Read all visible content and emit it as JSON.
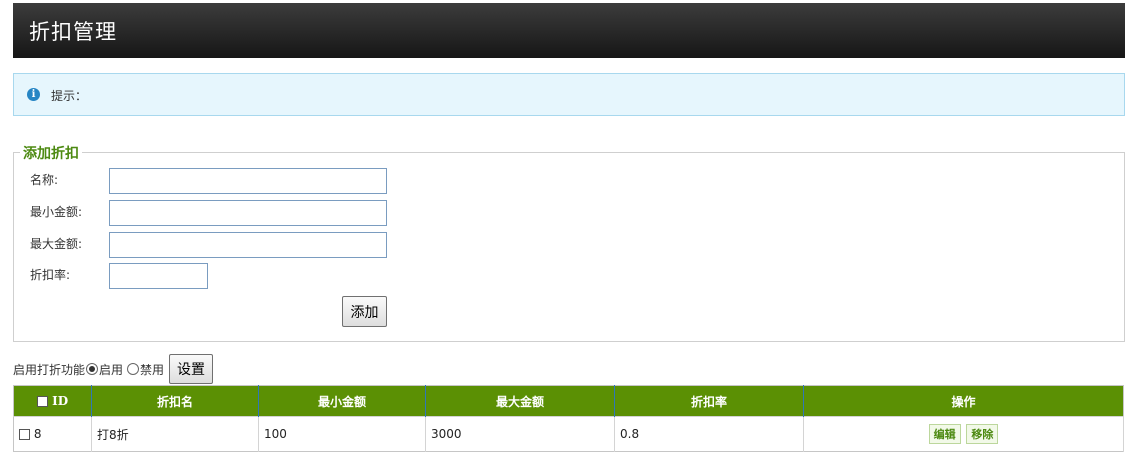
{
  "header": {
    "title": "折扣管理"
  },
  "tip": {
    "text": "提示："
  },
  "form": {
    "legend": "添加折扣",
    "name_label": "名称:",
    "name_value": "",
    "min_label": "最小金额:",
    "min_value": "",
    "max_label": "最大金额:",
    "max_value": "",
    "rate_label": "折扣率:",
    "rate_value": "",
    "submit_label": "添加"
  },
  "toggle": {
    "label": "启用打折功能",
    "enable_label": "启用",
    "disable_label": "禁用",
    "selected": "enable",
    "set_label": "设置"
  },
  "table": {
    "headers": [
      "ID",
      "折扣名",
      "最小金额",
      "最大金额",
      "折扣率",
      "操作"
    ],
    "rows": [
      {
        "id": "8",
        "name": "打8折",
        "min": "100",
        "max": "3000",
        "rate": "0.8",
        "edit": "编辑",
        "remove": "移除"
      }
    ]
  },
  "colors": {
    "header_bg": "#2b2b2b",
    "table_header": "#5b9004",
    "legend": "#4d8a12",
    "tip_bg": "#e6f6fd"
  }
}
